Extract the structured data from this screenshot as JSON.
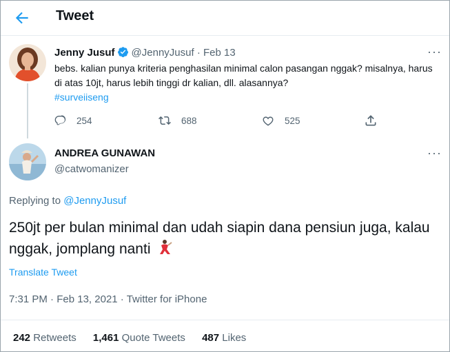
{
  "header": {
    "title": "Tweet"
  },
  "parent_tweet": {
    "name": "Jenny Jusuf",
    "handle": "@JennyJusuf",
    "separator": "·",
    "date": "Feb 13",
    "text": "bebs. kalian punya kriteria penghasilan minimal calon pasangan nggak? misalnya, harus di atas 10jt, harus lebih tinggi dr kalian, dll. alasannya?",
    "hashtag": "#surveiiseng",
    "replies": "254",
    "retweets": "688",
    "likes": "525",
    "more": "···"
  },
  "reply_tweet": {
    "name": "ANDREA GUNAWAN",
    "handle": "@catwomanizer",
    "more": "···",
    "replying_prefix": "Replying to",
    "replying_to": "@JennyJusuf",
    "text": "250jt per bulan minimal dan udah siapin dana pensiun juga, kalau nggak, jomplang nanti",
    "translate": "Translate Tweet",
    "time": "7:31 PM",
    "sep": "·",
    "date": "Feb 13, 2021",
    "source": "Twitter for iPhone"
  },
  "stats": {
    "retweets_count": "242",
    "retweets_label": "Retweets",
    "quotes_count": "1,461",
    "quotes_label": "Quote Tweets",
    "likes_count": "487",
    "likes_label": "Likes"
  },
  "colors": {
    "accent": "#1d9bf0",
    "muted": "#536471",
    "text": "#0f1419"
  },
  "icons": [
    "back-arrow-icon",
    "verified-badge-icon",
    "reply-icon",
    "retweet-icon",
    "like-icon",
    "share-icon",
    "more-icon",
    "dancer-emoji-icon"
  ]
}
